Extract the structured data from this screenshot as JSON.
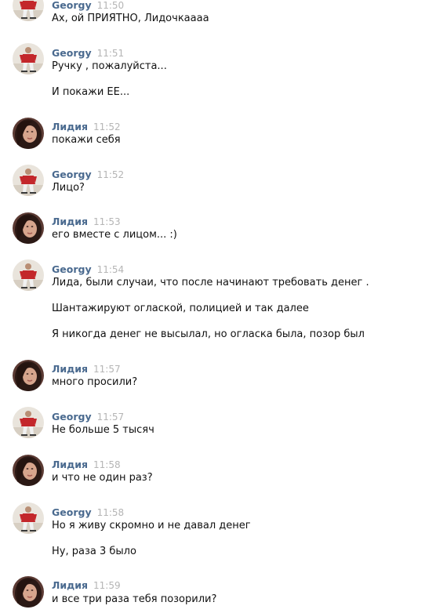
{
  "messages": [
    {
      "author": "Georgy",
      "time": "11:50",
      "avatar": "georgy-avatar-icon",
      "lines": [
        "Ах, ой ПРИЯТНО, Лидочкаааа"
      ]
    },
    {
      "author": "Georgy",
      "time": "11:51",
      "avatar": "georgy-avatar-icon",
      "lines": [
        "Ручку , пожалуйста...",
        "И покажи ЕЕ..."
      ]
    },
    {
      "author": "Лидия",
      "time": "11:52",
      "avatar": "lidiya-avatar-icon",
      "lines": [
        "покажи себя"
      ]
    },
    {
      "author": "Georgy",
      "time": "11:52",
      "avatar": "georgy-avatar-icon",
      "lines": [
        "Лицо?"
      ]
    },
    {
      "author": "Лидия",
      "time": "11:53",
      "avatar": "lidiya-avatar-icon",
      "lines": [
        "его вместе с лицом... :)"
      ]
    },
    {
      "author": "Georgy",
      "time": "11:54",
      "avatar": "georgy-avatar-icon",
      "lines": [
        "Лида, были случаи, что после начинают требовать денег .",
        "Шантажируют оглаской, полицией и так далее",
        "Я никогда денег не высылал, но огласка была, позор был"
      ]
    },
    {
      "author": "Лидия",
      "time": "11:57",
      "avatar": "lidiya-avatar-icon",
      "lines": [
        "много просили?"
      ]
    },
    {
      "author": "Georgy",
      "time": "11:57",
      "avatar": "georgy-avatar-icon",
      "lines": [
        "Не больше 5 тысяч"
      ]
    },
    {
      "author": "Лидия",
      "time": "11:58",
      "avatar": "lidiya-avatar-icon",
      "lines": [
        "и что не один раз?"
      ]
    },
    {
      "author": "Georgy",
      "time": "11:58",
      "avatar": "georgy-avatar-icon",
      "lines": [
        "Но я живу скромно и не давал денег",
        "Ну, раза 3 было"
      ]
    },
    {
      "author": "Лидия",
      "time": "11:59",
      "avatar": "lidiya-avatar-icon",
      "lines": [
        "и все три раза тебя позорили?"
      ]
    }
  ],
  "colors": {
    "author": "#4a6a8f",
    "time": "#b5b5b5",
    "text": "#111111",
    "background": "#ffffff"
  }
}
